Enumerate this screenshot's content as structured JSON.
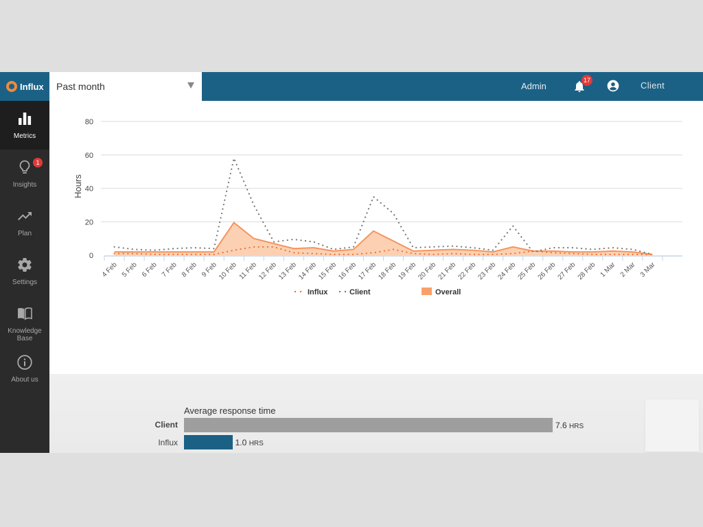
{
  "app": {
    "name": "Influx"
  },
  "header": {
    "period_select": {
      "value": "Past month",
      "options": [
        "Past month"
      ]
    },
    "admin_label": "Admin",
    "notifications_count": "17",
    "client_label": "Client"
  },
  "sidebar": {
    "items": [
      {
        "label": "Metrics",
        "icon": "bar-chart-icon",
        "active": true
      },
      {
        "label": "Insights",
        "icon": "lightbulb-icon",
        "badge": "1"
      },
      {
        "label": "Plan",
        "icon": "trending-up-icon"
      },
      {
        "label": "Settings",
        "icon": "gear-icon"
      },
      {
        "label": "Knowledge Base",
        "icon": "book-icon"
      },
      {
        "label": "About us",
        "icon": "info-icon"
      }
    ]
  },
  "colors": {
    "brand": "#1b6185",
    "influx": "#f0702a",
    "client": "#777777",
    "overall_fill": "#fcc9a6",
    "overall_line": "#f6935a",
    "client_bar": "#9e9e9e",
    "influx_bar": "#1b6185"
  },
  "chart_data": {
    "type": "line",
    "title": "",
    "xlabel": "",
    "ylabel": "Hours",
    "ylim": [
      0,
      80
    ],
    "yticks": [
      0,
      20,
      40,
      60,
      80
    ],
    "grid": true,
    "legend_position": "bottom",
    "categories": [
      "4 Feb",
      "5 Feb",
      "6 Feb",
      "7 Feb",
      "8 Feb",
      "9 Feb",
      "10 Feb",
      "11 Feb",
      "12 Feb",
      "13 Feb",
      "14 Feb",
      "15 Feb",
      "16 Feb",
      "17 Feb",
      "18 Feb",
      "19 Feb",
      "20 Feb",
      "21 Feb",
      "22 Feb",
      "23 Feb",
      "24 Feb",
      "25 Feb",
      "26 Feb",
      "27 Feb",
      "28 Feb",
      "1 Mar",
      "2 Mar",
      "3 Mar"
    ],
    "series": [
      {
        "name": "Influx",
        "style": "dotted",
        "values": [
          1,
          1,
          0.5,
          0.5,
          0.5,
          0.5,
          3,
          5,
          5,
          1.5,
          1,
          0.5,
          0.5,
          1.5,
          3.5,
          1,
          0.5,
          1,
          0.5,
          0.5,
          1,
          2.5,
          1.5,
          1,
          0.5,
          0.5,
          0.5,
          0.5
        ]
      },
      {
        "name": "Client",
        "style": "dotted",
        "values": [
          5,
          3.5,
          3,
          4,
          4.5,
          4,
          58,
          30,
          8,
          9.5,
          8,
          3.5,
          5,
          35,
          25,
          4.5,
          5,
          5.5,
          4.5,
          3,
          17.5,
          2,
          4.5,
          4.5,
          3.5,
          4.5,
          3.5,
          0.5
        ]
      },
      {
        "name": "Overall",
        "style": "area",
        "values": [
          2,
          2,
          2,
          2,
          2,
          2,
          19.5,
          10,
          7,
          4,
          4.5,
          2.5,
          3.5,
          14.5,
          8.5,
          2.5,
          3,
          3.5,
          3,
          2,
          5,
          2.5,
          2.5,
          2,
          2,
          2.5,
          2,
          0.5
        ]
      }
    ]
  },
  "response_time": {
    "title": "Average response time",
    "rows": [
      {
        "label": "Client",
        "value": 7.6,
        "display": "7.6",
        "unit": "HRS"
      },
      {
        "label": "Influx",
        "value": 1.0,
        "display": "1.0",
        "unit": "HRS"
      }
    ]
  }
}
